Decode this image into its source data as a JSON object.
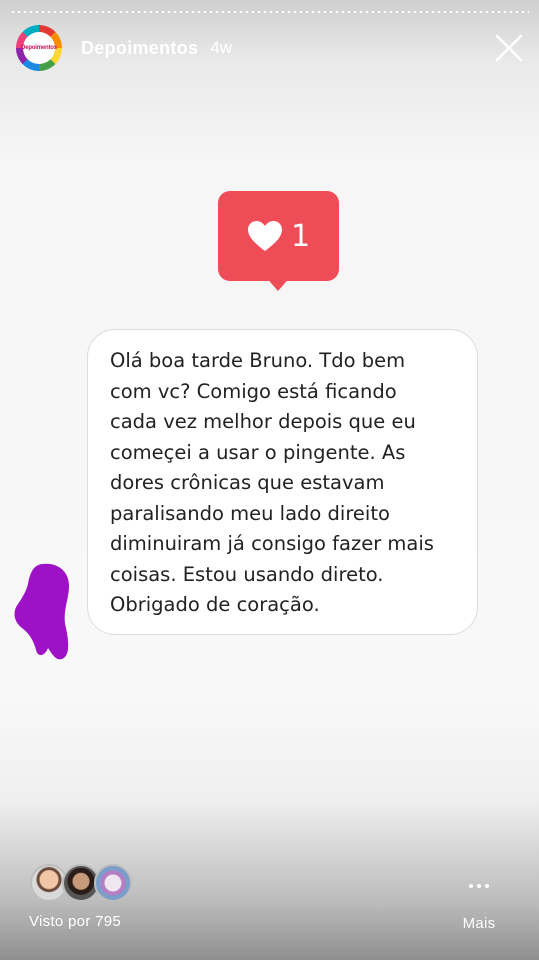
{
  "header": {
    "avatar_text": "Depoimentos",
    "account_name": "Depoimentos",
    "time_ago": "4w",
    "close_icon": "close-icon"
  },
  "sticker": {
    "icon": "heart-icon",
    "count": "1",
    "color": "#ee4c57"
  },
  "message": {
    "text": "Olá boa tarde Bruno. Tdo bem\ncom vc? Comigo está ficando\ncada vez melhor depois que eu\ncomeçei a usar o pingente. As\ndores crônicas que estavam\nparalisando meu lado direito\ndiminuiram já consigo fazer mais\ncoisas. Estou usando direto.\nObrigado de coração."
  },
  "annotation": {
    "color": "#9d12c4"
  },
  "footer": {
    "views_label": "Visto por 795",
    "more_label": "Mais",
    "more_icon": "more-horizontal-icon"
  }
}
